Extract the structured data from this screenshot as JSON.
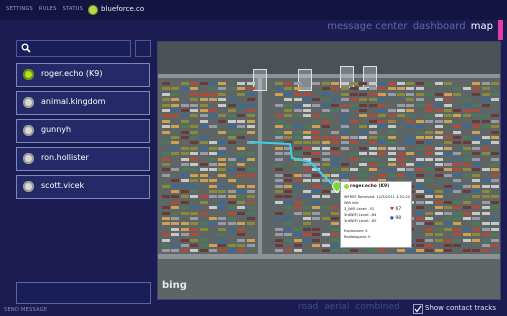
{
  "topbar": {
    "menu": [
      "SETTINGS",
      "RULES",
      "STATUS"
    ],
    "brand": "blueforce.co"
  },
  "nav": {
    "items": [
      "message center",
      "dashboard",
      "map"
    ],
    "active_index": 2
  },
  "search": {
    "value": "",
    "placeholder": ""
  },
  "contacts": [
    {
      "name": "roger.echo (K9)",
      "status": "online"
    },
    {
      "name": "animal.kingdom",
      "status": "offline"
    },
    {
      "name": "gunnyh",
      "status": "offline"
    },
    {
      "name": "ron.hollister",
      "status": "offline"
    },
    {
      "name": "scott.vicek",
      "status": "offline"
    }
  ],
  "message_box": {
    "value": ""
  },
  "send_label": "SEND MESSAGE",
  "map": {
    "attribution": "bing",
    "popup": {
      "title": "roger.echo (K9)",
      "lines": [
        "WFREE Received: 12/3/2011 3:51:20",
        "Wifi info",
        "3_WiFi Level: -51",
        "3rdWIFI Level: -64",
        "3rdWIFI Level: -65",
        "Explosives: 0",
        "Radiological: 0"
      ],
      "stats": [
        {
          "icon": "heart-icon",
          "value": "67"
        },
        {
          "icon": "droplet-icon",
          "value": "98"
        }
      ]
    }
  },
  "view_modes": [
    "road",
    "aerial",
    "combined"
  ],
  "show_tracks": {
    "label": "Show contact tracks",
    "checked": true
  },
  "colors": {
    "accent": "#e23fa6",
    "online": "#b0e020",
    "track": "#3fd0e8"
  }
}
